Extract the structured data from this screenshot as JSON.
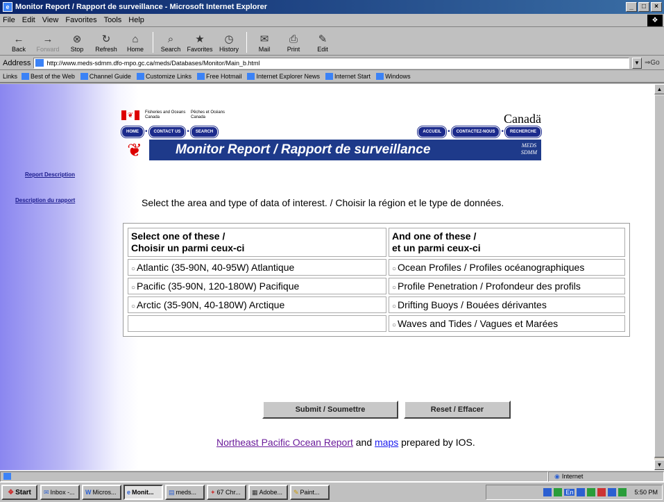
{
  "window": {
    "title": "Monitor Report / Rapport de surveillance - Microsoft Internet Explorer",
    "controls": [
      "_",
      "□",
      "×"
    ]
  },
  "menu": [
    "File",
    "Edit",
    "View",
    "Favorites",
    "Tools",
    "Help"
  ],
  "toolbar": [
    {
      "label": "Back",
      "icon": "back-arrow-icon",
      "glyph": "←"
    },
    {
      "label": "Forward",
      "icon": "forward-arrow-icon",
      "glyph": "→"
    },
    {
      "label": "Stop",
      "icon": "stop-icon",
      "glyph": "⊗"
    },
    {
      "label": "Refresh",
      "icon": "refresh-icon",
      "glyph": "↻"
    },
    {
      "label": "Home",
      "icon": "home-icon",
      "glyph": "⌂"
    },
    {
      "label": "Search",
      "icon": "search-icon",
      "glyph": "⌕"
    },
    {
      "label": "Favorites",
      "icon": "favorites-icon",
      "glyph": "★"
    },
    {
      "label": "History",
      "icon": "history-icon",
      "glyph": "◷"
    },
    {
      "label": "Mail",
      "icon": "mail-icon",
      "glyph": "✉"
    },
    {
      "label": "Print",
      "icon": "print-icon",
      "glyph": "⎙"
    },
    {
      "label": "Edit",
      "icon": "edit-icon",
      "glyph": "✎"
    }
  ],
  "address": {
    "label": "Address",
    "url": "http://www.meds-sdmm.dfo-mpo.gc.ca/meds/Databases/Monitor/Main_b.html",
    "go_label": "Go"
  },
  "links_bar": {
    "label": "Links",
    "items": [
      "Best of the Web",
      "Channel Guide",
      "Customize Links",
      "Free Hotmail",
      "Internet Explorer News",
      "Internet Start",
      "Windows"
    ]
  },
  "sidebar": {
    "items": [
      "Report Description",
      "Description du rapport"
    ]
  },
  "header": {
    "dept_en": "Fisheries and Oceans\nCanada",
    "dept_fr": "Pêches et Océans\nCanada",
    "wordmark": "Canadä",
    "nav_en": [
      "HOME",
      "CONTACT US",
      "SEARCH"
    ],
    "nav_fr": [
      "ACCUEIL",
      "CONTACTEZ-NOUS",
      "RECHERCHE"
    ],
    "banner_title": "Monitor Report / Rapport de surveillance",
    "banner_logo": "MEDS\nSDMM"
  },
  "instruction": "Select the area and type of data of interest. / Choisir la région et le type de données.",
  "table": {
    "col1_header": "Select one of these /\nChoisir un parmi ceux-ci",
    "col2_header": "And one of these /\net un parmi ceux-ci",
    "areas": [
      "Atlantic (35-90N, 40-95W) Atlantique",
      "Pacific (35-90N, 120-180W) Pacifique",
      "Arctic (35-90N, 40-180W) Arctique"
    ],
    "data_types": [
      "Ocean Profiles / Profiles océanographiques",
      "Profile Penetration / Profondeur des profils",
      "Drifting Buoys / Bouées dérivantes",
      "Waves and Tides / Vagues et Marées"
    ]
  },
  "buttons": {
    "submit": "Submit / Soumettre",
    "reset": "Reset / Effacer"
  },
  "footer": {
    "link1": "Northeast Pacific Ocean Report",
    "mid": " and ",
    "link2": "maps",
    "tail": " prepared by IOS."
  },
  "status": {
    "left": "",
    "zone": "Internet"
  },
  "taskbar": {
    "start": "Start",
    "tasks": [
      "Inbox -...",
      "Micros...",
      "Monit...",
      "meds...",
      "67 Chr...",
      "Adobe...",
      "Paint..."
    ],
    "active_index": 2,
    "tray_lang": "En",
    "clock": "5:50 PM"
  }
}
